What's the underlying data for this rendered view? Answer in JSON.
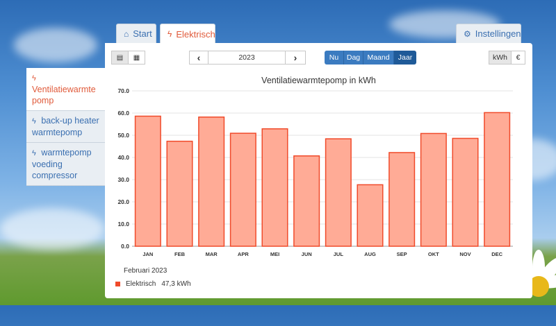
{
  "tabs": [
    {
      "label": "Start",
      "icon": "home-icon"
    },
    {
      "label": "Elektrisch",
      "icon": "bolt-icon"
    }
  ],
  "settings_label": "Instellingen",
  "sidebar": {
    "items": [
      {
        "label": "Ventilatiewarmtepomp",
        "active": true
      },
      {
        "label": "back-up heater warmtepomp",
        "active": false
      },
      {
        "label": "warmtepomp voeding compressor",
        "active": false
      }
    ]
  },
  "toolbar": {
    "year": "2023",
    "prev": "‹",
    "next": "›",
    "periods": [
      "Nu",
      "Dag",
      "Maand",
      "Jaar"
    ],
    "active_period": "Jaar",
    "units": [
      "kWh",
      "€"
    ],
    "active_unit": "kWh"
  },
  "chart_data": {
    "type": "bar",
    "title": "Ventilatiewarmtepomp in kWh",
    "categories": [
      "JAN",
      "FEB",
      "MAR",
      "APR",
      "MEI",
      "JUN",
      "JUL",
      "AUG",
      "SEP",
      "OKT",
      "NOV",
      "DEC"
    ],
    "series": [
      {
        "name": "Elektrisch",
        "values": [
          58.6,
          47.3,
          58.2,
          50.9,
          52.9,
          40.7,
          48.4,
          27.7,
          42.2,
          50.8,
          48.6,
          60.2
        ]
      }
    ],
    "ylim": [
      0,
      70
    ],
    "yticks": [
      "0.0",
      "10.0",
      "20.0",
      "30.0",
      "40.0",
      "50.0",
      "60.0",
      "70.0"
    ],
    "bar_fill": "#ffab96",
    "bar_stroke": "#f04a2a",
    "grid": true
  },
  "tooltip": {
    "date": "Februari 2023",
    "series": "Elektrisch",
    "value": "47,3 kWh"
  }
}
